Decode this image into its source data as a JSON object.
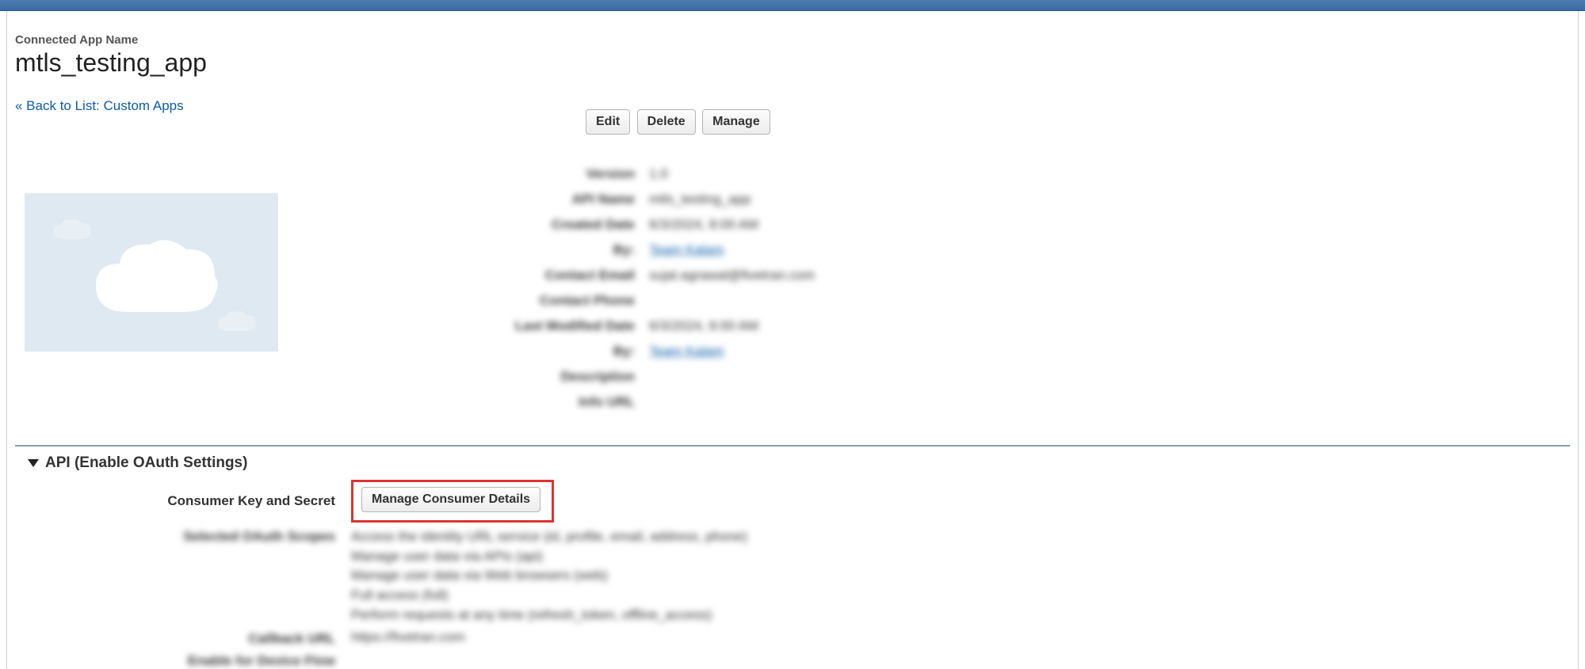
{
  "header": {
    "small_label": "Connected App Name",
    "app_name": "mtls_testing_app",
    "back_link": "« Back to List: Custom Apps"
  },
  "actions": {
    "edit": "Edit",
    "delete": "Delete",
    "manage": "Manage"
  },
  "info": {
    "version_label": "Version",
    "version_value": "1.0",
    "apiname_label": "API Name",
    "apiname_value": "mtls_testing_app",
    "created_label": "Created Date",
    "created_value": "6/3/2024, 8:00 AM",
    "created_by_label": "By:",
    "created_by_value": "Team Kalam",
    "contact_email_label": "Contact Email",
    "contact_email_value": "sujal.agrawal@fivetran.com",
    "contact_phone_label": "Contact Phone",
    "contact_phone_value": "",
    "lastmod_label": "Last Modified Date",
    "lastmod_value": "6/3/2024, 8:00 AM",
    "lastmod_by_label": "By:",
    "lastmod_by_value": "Team Kalam",
    "description_label": "Description",
    "description_value": "",
    "infourl_label": "Info URL",
    "infourl_value": ""
  },
  "api_section": {
    "title": "API (Enable OAuth Settings)",
    "consumer_label": "Consumer Key and Secret",
    "manage_consumer_btn": "Manage Consumer Details",
    "scopes_label": "Selected OAuth Scopes",
    "scopes": [
      "Access the identity URL service (id, profile, email, address, phone)",
      "Manage user data via APIs (api)",
      "Manage user data via Web browsers (web)",
      "Full access (full)",
      "Perform requests at any time (refresh_token, offline_access)"
    ],
    "callback_label": "Callback URL",
    "callback_value": "https://fivetran.com",
    "deviceflow_label": "Enable for Device Flow",
    "deviceflow_value": ""
  }
}
